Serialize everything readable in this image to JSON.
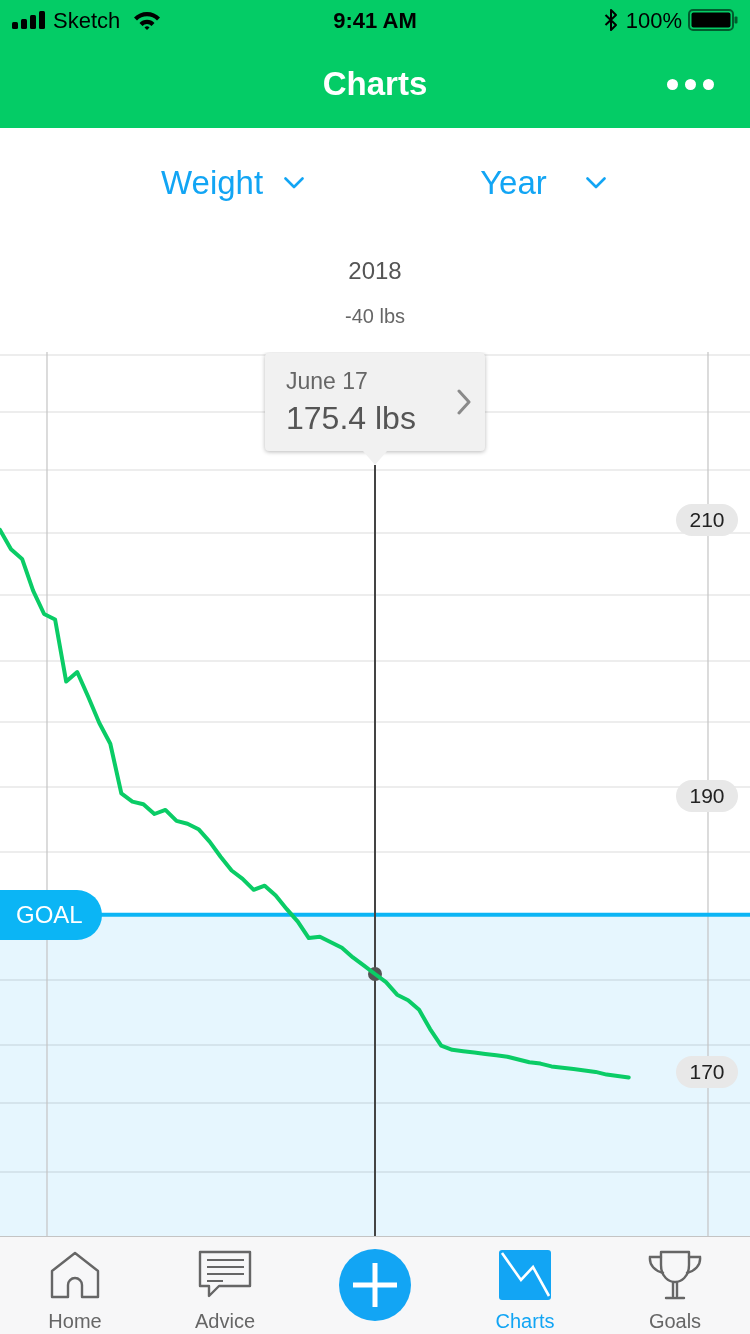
{
  "status_bar": {
    "carrier": "Sketch",
    "time": "9:41 AM",
    "battery": "100%"
  },
  "nav_bar": {
    "title": "Charts"
  },
  "selectors": [
    {
      "label": "Weight"
    },
    {
      "label": "Year"
    }
  ],
  "summary": {
    "period": "2018",
    "change": "-40 lbs"
  },
  "chart": {
    "tooltip": {
      "date": "June 17",
      "value": "175.4 lbs"
    },
    "chart_data": {
      "type": "line",
      "ylim": [
        158.1,
        222.2
      ],
      "yticks": [
        170,
        190,
        210
      ],
      "categories": [
        null,
        null,
        null,
        null,
        null,
        null,
        null,
        null,
        null,
        null,
        null,
        null,
        null,
        null,
        null,
        null,
        null,
        null,
        null,
        null,
        null,
        null,
        null,
        null,
        null,
        null,
        null,
        null,
        null,
        null,
        null,
        null,
        null,
        null,
        null,
        null,
        null,
        null,
        null,
        null,
        null,
        null,
        null,
        null,
        null,
        null,
        null,
        null,
        null,
        null,
        null,
        null,
        null,
        null,
        null,
        null,
        null,
        null,
        null,
        null,
        null,
        null,
        null,
        null,
        null,
        null,
        null,
        null,
        null
      ],
      "series": [
        {
          "color": "#0acc66",
          "values": [
            209.3,
            207.9,
            207.2,
            204.9,
            203.2,
            202.8,
            198.3,
            199.0,
            197.2,
            195.3,
            193.8,
            190.2,
            189.6,
            189.4,
            188.7,
            189.0,
            188.2,
            188.0,
            187.6,
            186.7,
            185.6,
            184.6,
            184.0,
            183.2,
            183.5,
            182.8,
            181.8,
            180.9,
            179.7,
            179.8,
            179.4,
            179.0,
            178.3,
            177.7,
            177.1,
            176.5,
            175.6,
            175.2,
            174.5,
            173.1,
            171.9,
            171.6,
            171.5,
            171.4,
            171.3,
            171.2,
            171.1,
            170.9,
            170.7,
            170.6,
            170.4,
            170.3,
            170.2,
            170.1,
            170.0,
            169.8,
            169.7,
            169.6,
            null,
            null,
            null,
            null,
            null,
            null,
            null,
            null,
            null,
            null,
            null
          ]
        }
      ],
      "ref_lines": [
        {
          "axis": "y",
          "value": 181.4,
          "label": "GOAL"
        }
      ]
    }
  },
  "tab_bar": {
    "items": [
      {
        "kind": "home",
        "label": "Home",
        "selected": false
      },
      {
        "kind": "advice",
        "label": "Advice",
        "selected": false
      },
      {
        "kind": "add",
        "selected": false
      },
      {
        "kind": "charts",
        "label": "Charts",
        "selected": true
      },
      {
        "kind": "goals",
        "label": "Goals",
        "selected": false
      }
    ]
  }
}
